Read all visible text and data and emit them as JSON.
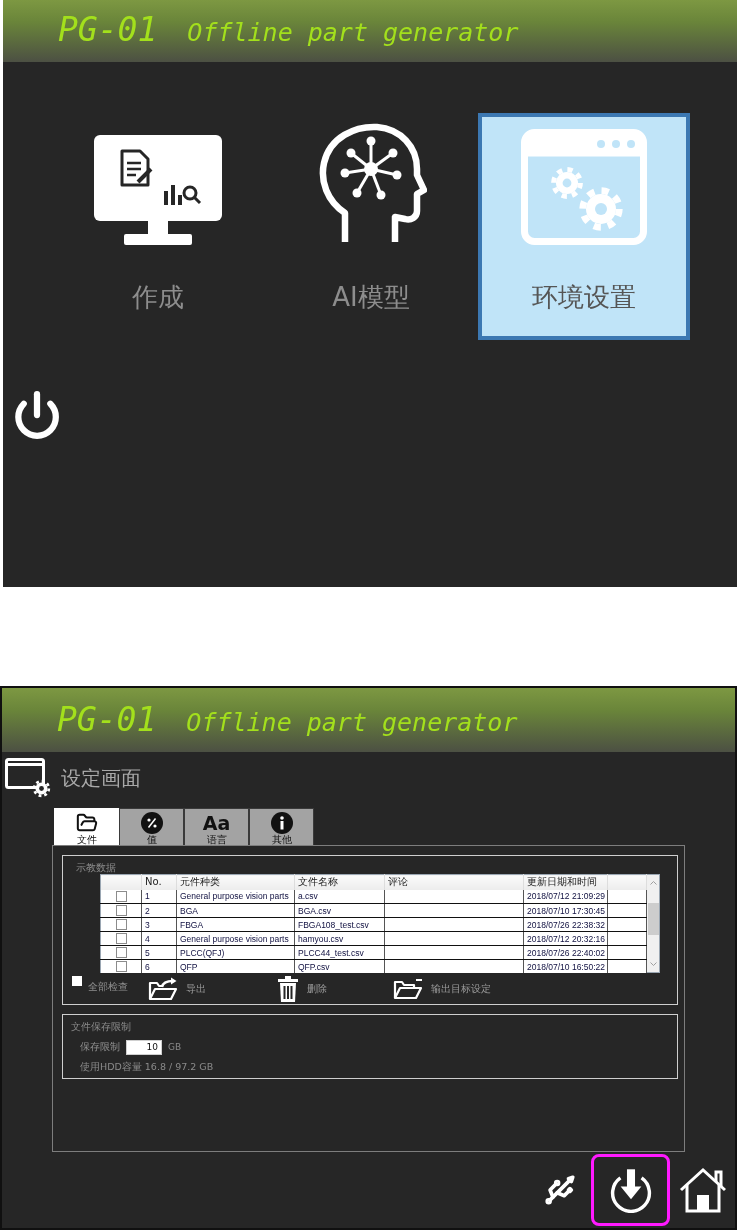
{
  "main_menu": {
    "header": {
      "code": "PG-01",
      "title": "Offline part generator"
    },
    "tiles": [
      {
        "kind": "create",
        "label": "作成",
        "selected": false
      },
      {
        "kind": "ai",
        "label": "AI模型",
        "selected": false
      },
      {
        "kind": "settings",
        "label": "环境设置",
        "selected": true
      }
    ]
  },
  "settings_screen": {
    "header": {
      "code": "PG-01",
      "title": "Offline part generator"
    },
    "title": "设定画面",
    "tabs": [
      {
        "kind": "file",
        "label": "文件",
        "selected": true
      },
      {
        "kind": "value",
        "label": "值",
        "selected": false
      },
      {
        "kind": "language",
        "glyph": "Aa",
        "label": "语言",
        "selected": false
      },
      {
        "kind": "info",
        "label": "其他",
        "selected": false
      }
    ],
    "teaching_data": {
      "title": "示教数据",
      "table": {
        "columns": [
          "No.",
          "元件种类",
          "文件名称",
          "评论",
          "更新日期和时间"
        ],
        "rows": [
          {
            "checked": false,
            "no": "1",
            "part_type": "General purpose vision parts",
            "file_name": "a.csv",
            "updated": "2018/07/12 21:09:29"
          },
          {
            "checked": false,
            "no": "2",
            "part_type": "BGA",
            "file_name": "BGA.csv",
            "updated": "2018/07/10 17:30:45"
          },
          {
            "checked": false,
            "no": "3",
            "part_type": "FBGA",
            "file_name": "FBGA108_test.csv",
            "updated": "2018/07/26 22:38:32"
          },
          {
            "checked": false,
            "no": "4",
            "part_type": "General purpose vision parts",
            "file_name": "hamyou.csv",
            "updated": "2018/07/12 20:32:16"
          },
          {
            "checked": false,
            "no": "5",
            "part_type": "PLCC(QFJ)",
            "file_name": "PLCC44_test.csv",
            "updated": "2018/07/26 22:40:02"
          },
          {
            "checked": false,
            "no": "6",
            "part_type": "QFP",
            "file_name": "QFP.csv",
            "updated": "2018/07/10 16:50:22"
          }
        ]
      },
      "check_all": {
        "label": "全部检查",
        "checked": false
      },
      "actions": [
        {
          "kind": "export",
          "label": "导出"
        },
        {
          "kind": "delete",
          "label": "删除"
        },
        {
          "kind": "output_folder",
          "label": "输出目标设定"
        }
      ]
    },
    "storage_limit": {
      "title": "文件保存限制",
      "limit_label": "保存限制",
      "limit_value": "10",
      "limit_unit": "GB",
      "usage": "使用HDD容量 16.8 / 97.2 GB"
    },
    "bottom_buttons": [
      {
        "kind": "usb",
        "selected": false
      },
      {
        "kind": "shutdown",
        "selected": true
      },
      {
        "kind": "home",
        "selected": false
      }
    ]
  }
}
